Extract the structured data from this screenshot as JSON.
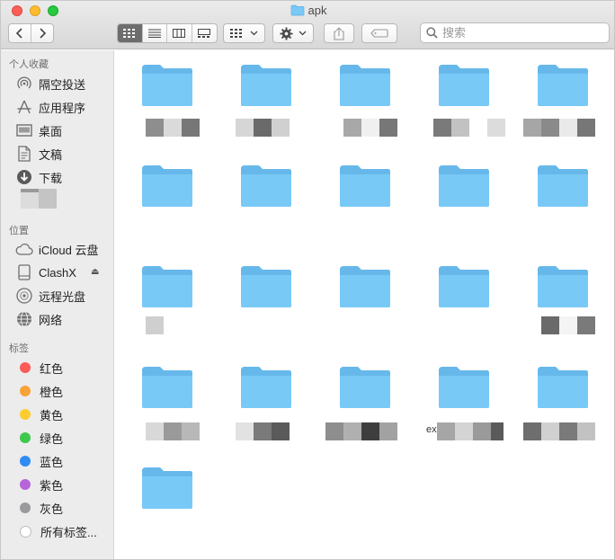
{
  "window": {
    "title": "apk"
  },
  "toolbar": {
    "view_modes": [
      "icon-view",
      "list-view",
      "column-view",
      "gallery-view"
    ],
    "active_view": "icon-view",
    "search_placeholder": "搜索"
  },
  "sidebar": {
    "favorites_header": "个人收藏",
    "favorites": [
      {
        "label": "隔空投送",
        "icon": "airdrop-icon"
      },
      {
        "label": "应用程序",
        "icon": "applications-icon"
      },
      {
        "label": "桌面",
        "icon": "desktop-icon"
      },
      {
        "label": "文稿",
        "icon": "documents-icon"
      },
      {
        "label": "下载",
        "icon": "downloads-icon"
      }
    ],
    "locations_header": "位置",
    "locations": [
      {
        "label": "iCloud 云盘",
        "icon": "icloud-icon"
      },
      {
        "label": "ClashX",
        "icon": "drive-icon"
      },
      {
        "label": "远程光盘",
        "icon": "disc-icon"
      },
      {
        "label": "网络",
        "icon": "network-icon"
      }
    ],
    "tags_header": "标签",
    "tags": [
      {
        "label": "红色",
        "color": "#fc5b57"
      },
      {
        "label": "橙色",
        "color": "#f8a23a"
      },
      {
        "label": "黄色",
        "color": "#fbcd30"
      },
      {
        "label": "绿色",
        "color": "#3ec84d"
      },
      {
        "label": "蓝色",
        "color": "#2f8cf4"
      },
      {
        "label": "紫色",
        "color": "#b665d8"
      },
      {
        "label": "灰色",
        "color": "#9a9a9c"
      },
      {
        "label": "所有标签...",
        "color": ""
      }
    ]
  },
  "content": {
    "folder_count": 21,
    "visible_label_fragment": "ex"
  },
  "colors": {
    "folder": "#79c9f7",
    "folder_tab": "#67b8ea",
    "accent": "#2f8cf4"
  }
}
